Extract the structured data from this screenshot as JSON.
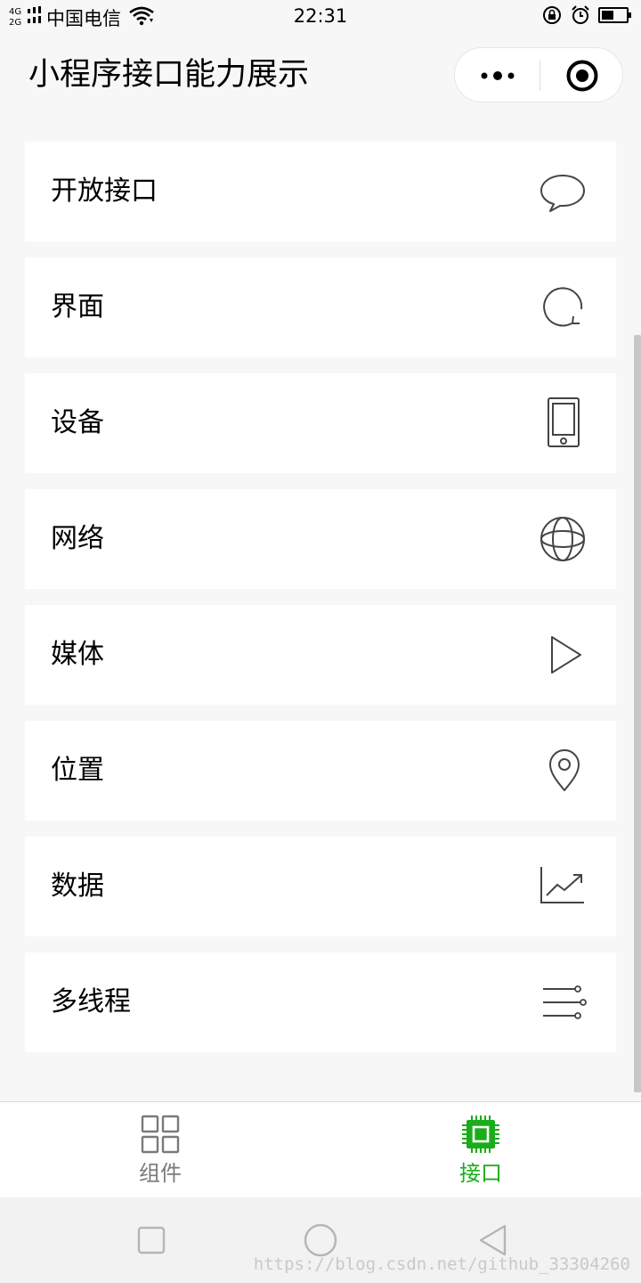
{
  "status_bar": {
    "network_top": "4G",
    "network_bottom": "2G",
    "carrier": "中国电信",
    "time": "22:31"
  },
  "nav": {
    "title": "小程序接口能力展示"
  },
  "items": [
    {
      "label": "开放接口",
      "icon": "chat-bubble-icon"
    },
    {
      "label": "界面",
      "icon": "refresh-circle-icon"
    },
    {
      "label": "设备",
      "icon": "phone-icon"
    },
    {
      "label": "网络",
      "icon": "globe-icon"
    },
    {
      "label": "媒体",
      "icon": "play-icon"
    },
    {
      "label": "位置",
      "icon": "location-pin-icon"
    },
    {
      "label": "数据",
      "icon": "line-chart-icon"
    },
    {
      "label": "多线程",
      "icon": "sliders-icon"
    }
  ],
  "tabbar": {
    "tabs": [
      {
        "label": "组件",
        "icon": "grid-icon",
        "active": false
      },
      {
        "label": "接口",
        "icon": "chip-icon",
        "active": true
      }
    ],
    "active_color": "#1aad19",
    "inactive_color": "#7a7a7a"
  },
  "watermark": "https://blog.csdn.net/github_33304260"
}
